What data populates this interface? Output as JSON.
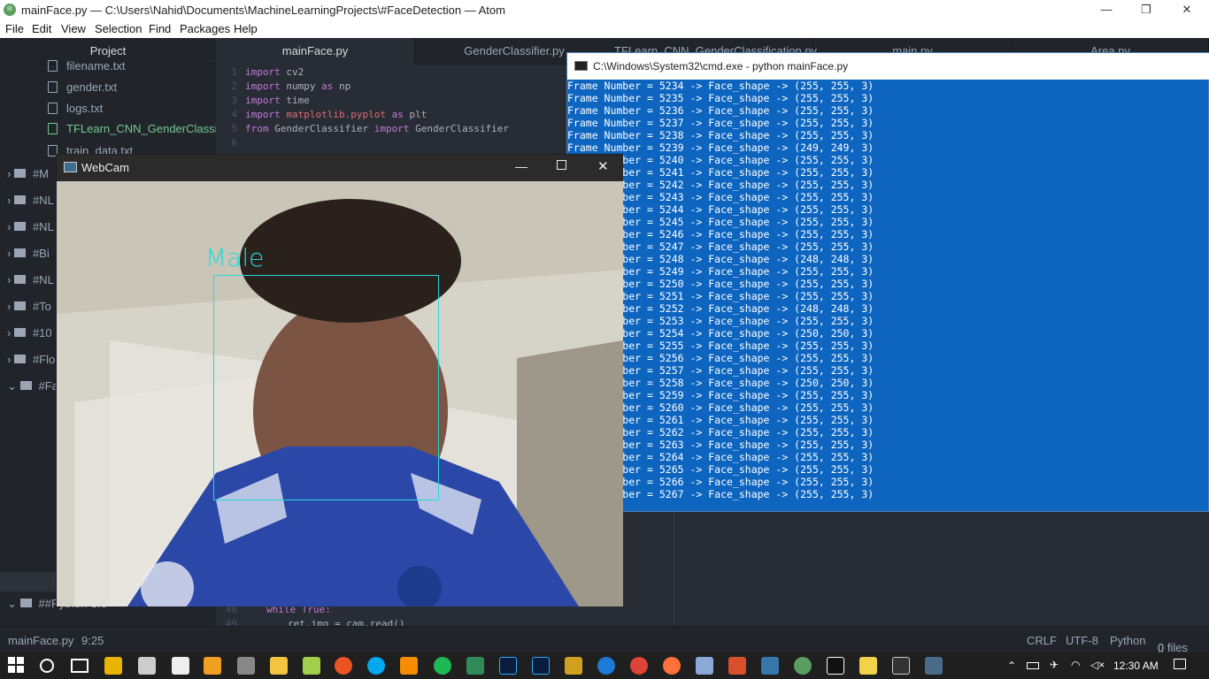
{
  "title_bar": {
    "title": "mainFace.py — C:\\Users\\Nahid\\Documents\\MachineLearningProjects\\#FaceDetection — Atom",
    "minimize": "—",
    "maximize": "❐",
    "close": "✕"
  },
  "menu": [
    "File",
    "Edit",
    "View",
    "Selection",
    "Find",
    "Packages",
    "Help"
  ],
  "tree": {
    "header": "Project",
    "files": [
      "filename.txt",
      "gender.txt",
      "logs.txt",
      "TFLearn_CNN_GenderClassific",
      "train_data.txt"
    ],
    "folders": [
      "#M",
      "#NL",
      "#NL",
      "#Bi",
      "#NL",
      "#To",
      "#10",
      "#Flo",
      "#Fa"
    ],
    "last_folder": "##Python-3.6"
  },
  "tabs": [
    "mainFace.py",
    "GenderClassifier.py",
    "TFLearn_CNN_GenderClassification.py",
    "main.py",
    "Area.py"
  ],
  "editor": {
    "line_numbers": [
      "1",
      "2",
      "3",
      "4",
      "5",
      "6"
    ],
    "lines": [
      {
        "k1": "import",
        "t1": " cv2",
        "k2": "",
        "t2": ""
      },
      {
        "k1": "import",
        "t1": " numpy ",
        "k2": "as",
        "t2": " np"
      },
      {
        "k1": "import",
        "t1": " time",
        "k2": "",
        "t2": ""
      },
      {
        "k1": "import",
        "t1": " matplotlib.pyplot ",
        "k2": "as",
        "t2": " plt"
      },
      {
        "k1": "from",
        "t1": " GenderClassifier ",
        "k2": "import",
        "t2": " GenderClassifier"
      }
    ],
    "line48_num": "48",
    "line48": "while True:",
    "line49_num": "49",
    "line49": "ret,img = cam.read()"
  },
  "status": {
    "file": "mainFace.py",
    "cursor": "9:25",
    "eol": "CRLF",
    "encoding": "UTF-8",
    "grammar": "Python",
    "files": "0 files"
  },
  "cmd": {
    "title": "C:\\Windows\\System32\\cmd.exe - python  mainFace.py",
    "lines": [
      "Frame Number = 5234 -> Face_shape -> (255, 255, 3)",
      "Frame Number = 5235 -> Face_shape -> (255, 255, 3)",
      "Frame Number = 5236 -> Face_shape -> (255, 255, 3)",
      "Frame Number = 5237 -> Face_shape -> (255, 255, 3)",
      "Frame Number = 5238 -> Face_shape -> (255, 255, 3)",
      "Frame Number = 5239 -> Face_shape -> (249, 249, 3)",
      "Frame Number = 5240 -> Face_shape -> (255, 255, 3)",
      "Frame Number = 5241 -> Face_shape -> (255, 255, 3)",
      "Frame Number = 5242 -> Face_shape -> (255, 255, 3)",
      "Frame Number = 5243 -> Face_shape -> (255, 255, 3)",
      "Frame Number = 5244 -> Face_shape -> (255, 255, 3)",
      "Frame Number = 5245 -> Face_shape -> (255, 255, 3)",
      "Frame Number = 5246 -> Face_shape -> (255, 255, 3)",
      "Frame Number = 5247 -> Face_shape -> (255, 255, 3)",
      "Frame Number = 5248 -> Face_shape -> (248, 248, 3)",
      "Frame Number = 5249 -> Face_shape -> (255, 255, 3)",
      "Frame Number = 5250 -> Face_shape -> (255, 255, 3)",
      "Frame Number = 5251 -> Face_shape -> (255, 255, 3)",
      "Frame Number = 5252 -> Face_shape -> (248, 248, 3)",
      "Frame Number = 5253 -> Face_shape -> (255, 255, 3)",
      "Frame Number = 5254 -> Face_shape -> (250, 250, 3)",
      "Frame Number = 5255 -> Face_shape -> (255, 255, 3)",
      "Frame Number = 5256 -> Face_shape -> (255, 255, 3)",
      "Frame Number = 5257 -> Face_shape -> (255, 255, 3)",
      "Frame Number = 5258 -> Face_shape -> (250, 250, 3)",
      "Frame Number = 5259 -> Face_shape -> (255, 255, 3)",
      "Frame Number = 5260 -> Face_shape -> (255, 255, 3)",
      "Frame Number = 5261 -> Face_shape -> (255, 255, 3)",
      "Frame Number = 5262 -> Face_shape -> (255, 255, 3)",
      "Frame Number = 5263 -> Face_shape -> (255, 255, 3)",
      "Frame Number = 5264 -> Face_shape -> (255, 255, 3)",
      "Frame Number = 5265 -> Face_shape -> (255, 255, 3)",
      "Frame Number = 5266 -> Face_shape -> (255, 255, 3)",
      "Frame Number = 5267 -> Face_shape -> (255, 255, 3)"
    ]
  },
  "webcam": {
    "title": "WebCam",
    "label": "Male",
    "face_box_color": "#22d9d9"
  },
  "taskbar": {
    "time": "12:30 AM"
  },
  "colors": {
    "atom_bg": "#282c34",
    "tree_bg": "#21252b",
    "cmd_bg": "#0d65c0",
    "green_file": "#73c990"
  }
}
